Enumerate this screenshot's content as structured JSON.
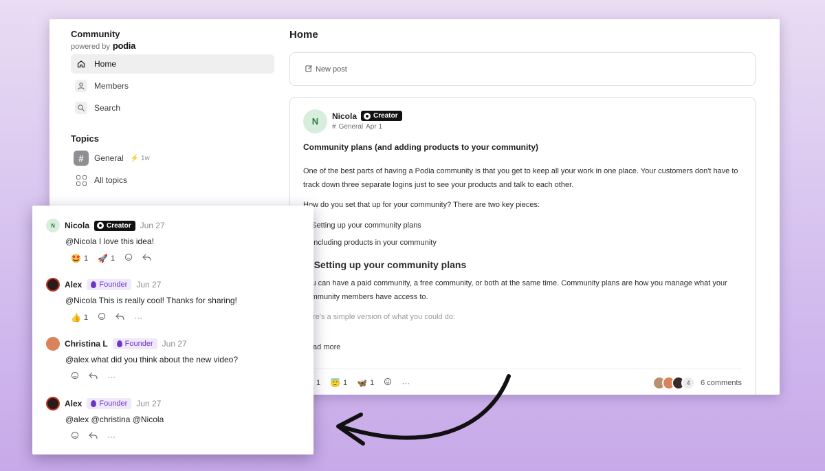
{
  "sidebar": {
    "brand": "Community",
    "powered_by": "powered by",
    "logo": "podia",
    "nav": [
      {
        "label": "Home",
        "icon": "home-icon"
      },
      {
        "label": "Members",
        "icon": "user-icon"
      },
      {
        "label": "Search",
        "icon": "search-icon"
      }
    ],
    "topics_title": "Topics",
    "topics": [
      {
        "label": "General",
        "meta": "1w"
      },
      {
        "label": "All topics"
      }
    ]
  },
  "main": {
    "title": "Home",
    "new_post": "New post",
    "post": {
      "avatar_initial": "N",
      "author": "Nicola",
      "badge": "Creator",
      "topic": "General",
      "date": "Apr 1",
      "title": "Community plans (and adding products to your community)",
      "para1": "One of the best parts of having a Podia community is that you get to keep all your work in one place. Your customers don't have to track down three separate logins just to see your products and talk to each other.",
      "para2": "How do you set that up for your community? There are two key pieces:",
      "list": [
        "1. Setting up your community plans",
        "2. Including products in your community"
      ],
      "heading": "1. Setting up your community plans",
      "para3": "You can have a paid community, a free community, or both at the same time. Community plans are how you manage what your community members have access to.",
      "para4": "Here's a simple version of what you could do:",
      "read_more": "Read more",
      "reactions": [
        {
          "emoji": "🤩",
          "count": "1"
        },
        {
          "emoji": "😇",
          "count": "1"
        },
        {
          "emoji": "🦋",
          "count": "1"
        }
      ],
      "extra_commenters": "4",
      "comments_count": "6 comments"
    }
  },
  "comments": [
    {
      "author": "Nicola",
      "badge": "Creator",
      "badge_type": "creator",
      "date": "Jun 27",
      "text": "@Nicola I love this idea!",
      "reactions": [
        {
          "emoji": "🤩",
          "count": "1"
        },
        {
          "emoji": "🚀",
          "count": "1"
        }
      ],
      "more": false
    },
    {
      "author": "Alex",
      "badge": "Founder",
      "badge_type": "founder",
      "date": "Jun 27",
      "text": "@Nicola This is really cool! Thanks for sharing!",
      "reactions": [
        {
          "emoji": "👍",
          "count": "1"
        }
      ],
      "more": true
    },
    {
      "author": "Christina L",
      "badge": "Founder",
      "badge_type": "founder",
      "date": "Jun 27",
      "text": "@alex what did you think about the new video?",
      "reactions": [],
      "more": true
    },
    {
      "author": "Alex",
      "badge": "Founder",
      "badge_type": "founder",
      "date": "Jun 27",
      "text": "@alex @christina @Nicola",
      "reactions": [],
      "more": true
    }
  ],
  "colors": {
    "background": "#d3bdee",
    "founder_badge_bg": "#f1e9fb",
    "founder_badge_text": "#6d35c7",
    "creator_badge_bg": "#111111"
  }
}
